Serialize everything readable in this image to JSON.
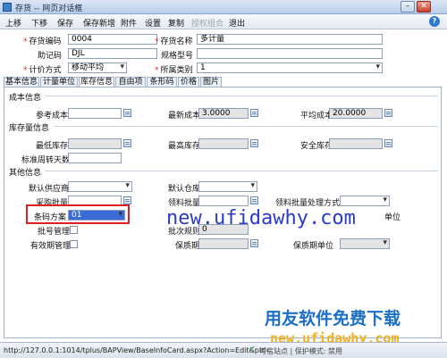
{
  "window": {
    "title": "存货 -- 网页对话框",
    "icon": "app-icon"
  },
  "toolbar": {
    "items": [
      "上移",
      "下移",
      "保存",
      "保存新增",
      "附件",
      "设置",
      "复制",
      "授权组合",
      "退出"
    ],
    "help": "?"
  },
  "header": {
    "code_label": "存货编码",
    "code_value": "0004",
    "name_label": "存货名称",
    "name_value": "多计量",
    "mnemonic_label": "助记码",
    "mnemonic_value": "DJL",
    "spec_label": "规格型号",
    "spec_value": "",
    "valuation_label": "计价方式",
    "valuation_value": "移动平均",
    "category_label": "所属类别",
    "category_value": "1"
  },
  "tabs": [
    "基本信息",
    "计量单位",
    "库存信息",
    "自由项",
    "条形码",
    "价格",
    "图片"
  ],
  "active_tab": "库存信息",
  "cost": {
    "section": "成本信息",
    "ref_label": "参考成本",
    "ref_value": "",
    "latest_label": "最新成本",
    "latest_value": "3.0000",
    "avg_label": "平均成本",
    "avg_value": "20.0000"
  },
  "stock": {
    "section": "库存量信息",
    "min_label": "最低库存",
    "max_label": "最高库存",
    "safe_label": "安全库存",
    "cycle_label": "标准周转天数"
  },
  "other": {
    "section": "其他信息",
    "supplier_label": "默认供应商",
    "warehouse_label": "默认仓库",
    "purchase_batch_label": "采购批量",
    "picking_batch_label": "领料批量",
    "picking_method_label": "领料批量处理方式",
    "barcode_label": "条码方案",
    "barcode_value": "01",
    "batch_mgmt_label": "批号管理",
    "batch_rule_label": "批次规则",
    "batch_rule_value": "0",
    "unit_label": "单位",
    "expiry_mgmt_label": "有效期管理",
    "expiry_label": "保质期",
    "expiry_unit_label": "保质期单位"
  },
  "watermark": {
    "url": "new.ufidawhy.com",
    "brand_cn": "用友软件免费下载",
    "url2": "new.ufidawhy.com"
  },
  "status": {
    "url": "http://127.0.0.1:1014/tplus/BAPView/BaseInfoCard.aspx?Action=Edit&pId=",
    "text": "可信站点 | 保护模式: 禁用"
  },
  "colors": {
    "highlight": "#e02020",
    "watermark": "#2a3acb",
    "brand": "#1a6fc8"
  }
}
